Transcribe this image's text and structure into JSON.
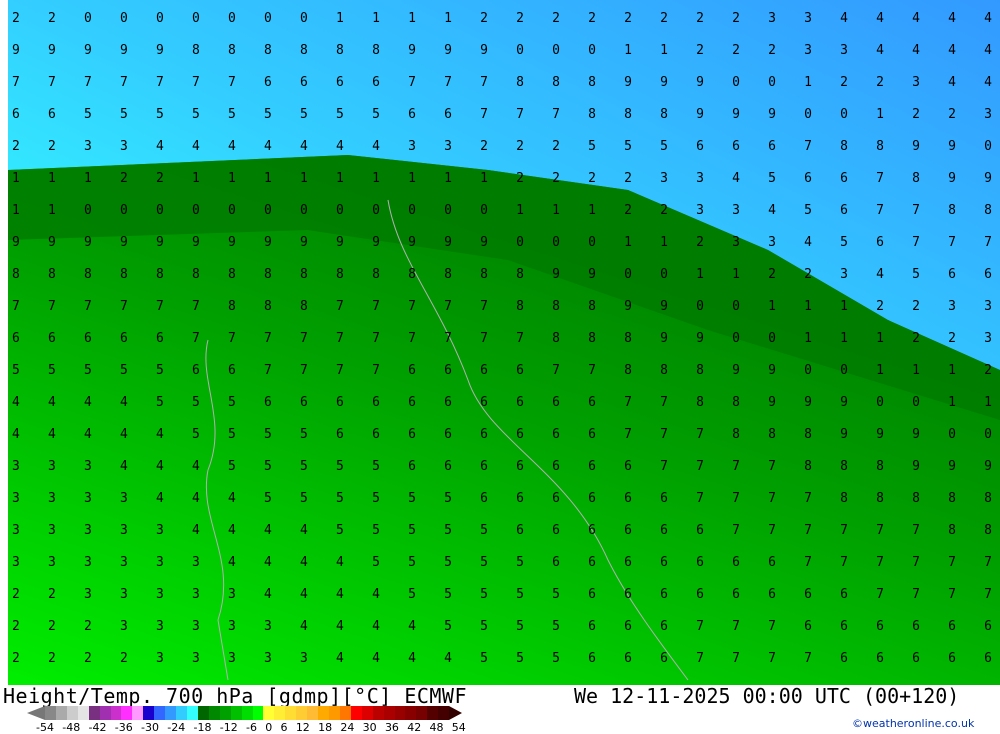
{
  "title": "Height/Temp. 700 hPa [gdmp][°C] ECMWF",
  "valid_time": "We 12-11-2025 00:00 UTC (00+120)",
  "credit": "©weatheronline.co.uk",
  "legend": {
    "ticks": [
      "-54",
      "-48",
      "-42",
      "-36",
      "-30",
      "-24",
      "-18",
      "-12",
      "-6",
      "0",
      "6",
      "12",
      "18",
      "24",
      "30",
      "36",
      "42",
      "48",
      "54"
    ],
    "colors": [
      "#888888",
      "#aaaaaa",
      "#cccccc",
      "#e4e4e4",
      "#7a3080",
      "#a030b0",
      "#cc30cc",
      "#ff30ff",
      "#ff99ff",
      "#1a00cc",
      "#3366ff",
      "#3399ff",
      "#33ccff",
      "#33ffff",
      "#006600",
      "#008800",
      "#00a000",
      "#00c000",
      "#00dd00",
      "#00ff00",
      "#ffff33",
      "#ffee33",
      "#ffdd33",
      "#ffcc33",
      "#ffbb33",
      "#ffaa00",
      "#ff9900",
      "#ff7700",
      "#ff0000",
      "#dd0000",
      "#bb0000",
      "#aa0000",
      "#990000",
      "#880000",
      "#770000",
      "#550000",
      "#440000"
    ]
  },
  "map_rows": [
    "2 2 0 0 0 0 0 0 0 1 1 1 1 2 2 2 2 2 2 2 2 3 3 4 4 4 4 4",
    "9 9 9 9 9 8 8 8 8 8 8 9 9 9 0 0 0 1 1 2 2 2 3 3 4 4 4 4",
    "7 7 7 7 7 7 7 6 6 6 6 7 7 7 8 8 8 9 9 9 0 0 1 2 2 3 4 4",
    "6 6 5 5 5 5 5 5 5 5 5 6 6 7 7 7 8 8 8 9 9 9 0 0 1 2 2 3",
    "2 2 3 3 4 4 4 4 4 4 4 3 3 2 2 2 5 5 5 6 6 6 7 8 8 9 9 0",
    "1 1 1 2 2 1 1 1 1 1 1 1 1 1 2 2 2 2 3 3 4 5 6 6 7 8 9 9",
    "1 1 0 0 0 0 0 0 0 0 0 0 0 0 1 1 1 2 2 3 3 4 5 6 7 7 8 8",
    "9 9 9 9 9 9 9 9 9 9 9 9 9 9 0 0 0 1 1 2 3 3 4 5 6 7 7 7",
    "8 8 8 8 8 8 8 8 8 8 8 8 8 8 8 9 9 0 0 1 1 2 2 3 4 5 6 6",
    "7 7 7 7 7 7 8 8 8 7 7 7 7 7 8 8 8 9 9 0 0 1 1 1 2 2 3 3",
    "6 6 6 6 6 7 7 7 7 7 7 7 7 7 7 8 8 8 9 9 0 0 1 1 1 2 2 3",
    "5 5 5 5 5 6 6 7 7 7 7 6 6 6 6 7 7 8 8 8 9 9 0 0 1 1 1 2",
    "4 4 4 4 5 5 5 6 6 6 6 6 6 6 6 6 6 7 7 8 8 9 9 9 0 0 1 1",
    "4 4 4 4 4 5 5 5 5 6 6 6 6 6 6 6 6 7 7 7 8 8 8 9 9 9 0 0",
    "3 3 3 4 4 4 5 5 5 5 5 6 6 6 6 6 6 6 7 7 7 7 8 8 8 9 9 9",
    "3 3 3 3 4 4 4 5 5 5 5 5 5 6 6 6 6 6 6 7 7 7 7 8 8 8 8 8",
    "3 3 3 3 3 4 4 4 4 5 5 5 5 5 6 6 6 6 6 6 7 7 7 7 7 7 8 8",
    "3 3 3 3 3 3 4 4 4 4 5 5 5 5 5 6 6 6 6 6 6 6 7 7 7 7 7 7",
    "2 2 3 3 3 3 3 4 4 4 4 5 5 5 5 5 6 6 6 6 6 6 6 6 7 7 7 7",
    "2 2 2 3 3 3 3 3 4 4 4 4 5 5 5 5 6 6 6 7 7 7 6 6 6 6 6 6",
    "2 2 2 2 3 3 3 3 3 4 4 4 4 5 5 5 6 6 6 7 7 7 7 6 6 6 6 6"
  ]
}
